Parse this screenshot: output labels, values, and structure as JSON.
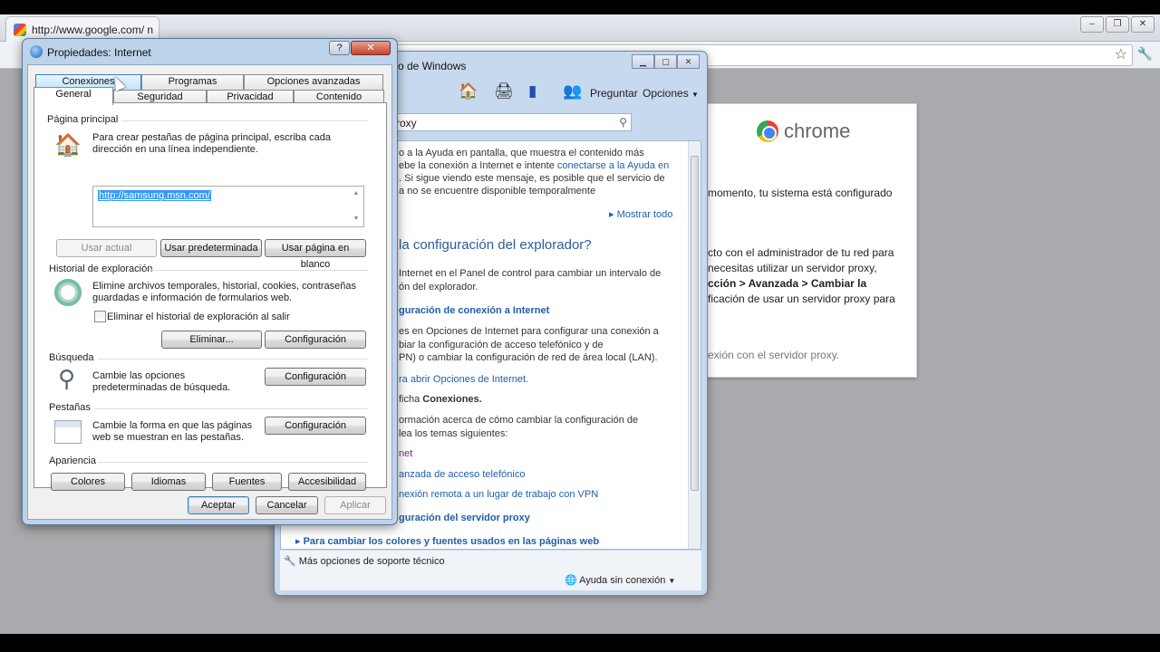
{
  "chrome": {
    "tab_title": "http://www.google.com/ n",
    "logo_text": "chrome",
    "card_lines": [
      "momento, tu sistema está configurado",
      "cto con el administrador de tu red para",
      "necesitas utilizar un servidor proxy,",
      "cción > Avanzada > Cambiar la",
      "ficación de usar un servidor proxy para",
      "exión con el servidor proxy."
    ]
  },
  "help": {
    "title": "co de Windows",
    "toolbar": {
      "ask": "Preguntar",
      "options": "Opciones"
    },
    "search_value": "roxy",
    "content": {
      "p1": [
        "o a la Ayuda en pantalla, que muestra el contenido más",
        "ebe la conexión a Internet e intente ",
        "conectarse a la Ayuda en",
        ". Si sigue viendo este mensaje, es posible que el servicio de",
        "a no se encuentre disponible temporalmente"
      ],
      "show_all": "Mostrar todo",
      "heading": "la configuración del explorador?",
      "p2": [
        "Internet en el Panel de control para cambiar un intervalo de",
        "ón del explorador."
      ],
      "sub1": "guración de conexión a Internet",
      "p3": [
        "es en Opciones de Internet para configurar una conexión a",
        "biar la configuración de acceso telefónico y de",
        "PN) o cambiar la configuración de red de área local (LAN)."
      ],
      "open_link": "ra abrir Opciones de Internet.",
      "tab_line_pre": "ficha ",
      "tab_line_bold": "Conexiones.",
      "p4": [
        "ormación acerca de cómo cambiar la configuración de",
        "lea los temas siguientes:"
      ],
      "link_net": "net",
      "link_dial": "anzada de acceso telefónico",
      "link_vpn": "nexión remota a un lugar de trabajo con VPN",
      "sub2": "guración del servidor proxy",
      "sub3": "Para cambiar los colores y fuentes usados en las páginas web"
    },
    "status": {
      "more": "Más opciones de soporte técnico",
      "offline": "Ayuda sin conexión"
    }
  },
  "dialog": {
    "title": "Propiedades: Internet",
    "tabs_back": [
      "Conexiones",
      "Programas",
      "Opciones avanzadas"
    ],
    "tabs_front": [
      "General",
      "Seguridad",
      "Privacidad",
      "Contenido"
    ],
    "home": {
      "section": "Página principal",
      "desc": "Para crear pestañas de página principal, escriba cada dirección en una línea independiente.",
      "url": "http://samsung.msn.com/",
      "btn_current": "Usar actual",
      "btn_default": "Usar predeterminada",
      "btn_blank": "Usar página en blanco"
    },
    "history": {
      "section": "Historial de exploración",
      "desc": "Elimine archivos temporales, historial, cookies, contraseñas guardadas e información de formularios web.",
      "checkbox": "Eliminar el historial de exploración al salir",
      "btn_delete": "Eliminar...",
      "btn_settings": "Configuración"
    },
    "search": {
      "section": "Búsqueda",
      "desc": "Cambie las opciones predeterminadas de búsqueda.",
      "btn_settings": "Configuración"
    },
    "tabs_section": {
      "section": "Pestañas",
      "desc": "Cambie la forma en que las páginas web se muestran en las pestañas.",
      "btn_settings": "Configuración"
    },
    "appearance": {
      "section": "Apariencia",
      "btn_colors": "Colores",
      "btn_languages": "Idiomas",
      "btn_fonts": "Fuentes",
      "btn_accessibility": "Accesibilidad"
    },
    "footer": {
      "ok": "Aceptar",
      "cancel": "Cancelar",
      "apply": "Aplicar"
    }
  }
}
